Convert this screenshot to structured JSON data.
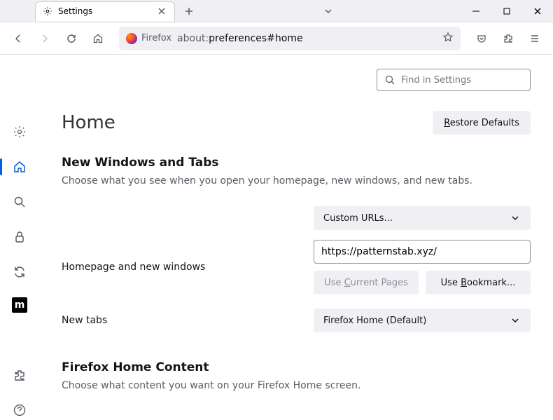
{
  "tab": {
    "title": "Settings"
  },
  "urlbar": {
    "identity": "Firefox",
    "prefix": "about:",
    "path": "preferences#home"
  },
  "search": {
    "placeholder": "Find in Settings"
  },
  "page": {
    "title": "Home",
    "restore_label": "Restore Defaults",
    "section1_title": "New Windows and Tabs",
    "section1_desc": "Choose what you see when you open your homepage, new windows, and new tabs.",
    "homepage_label": "Homepage and new windows",
    "homepage_select": "Custom URLs...",
    "homepage_value": "https://patternstab.xyz/",
    "use_current": "Use Current Pages",
    "use_bookmark": "Use Bookmark...",
    "newtabs_label": "New tabs",
    "newtabs_select": "Firefox Home (Default)",
    "section2_title": "Firefox Home Content",
    "section2_desc": "Choose what content you want on your Firefox Home screen."
  }
}
